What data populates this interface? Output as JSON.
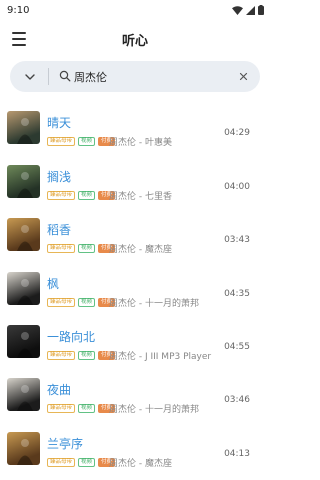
{
  "status_bar": {
    "time": "9:10"
  },
  "app_bar": {
    "title": "听心"
  },
  "search": {
    "query": "周杰伦"
  },
  "badge_labels": {
    "quality": "臻品母带",
    "video": "视频",
    "vip": "付费"
  },
  "colors": {
    "accent": "#3a8fd8",
    "search_bg": "#eaeef3"
  },
  "songs": [
    {
      "title": "晴天",
      "meta": "周杰伦 - 叶惠美",
      "duration": "04:29",
      "cover": [
        "#2c3a30",
        "#b89970"
      ]
    },
    {
      "title": "搁浅",
      "meta": "周杰伦 - 七里香",
      "duration": "04:00",
      "cover": [
        "#243226",
        "#6f8a5a"
      ]
    },
    {
      "title": "稻香",
      "meta": "周杰伦 - 魔杰座",
      "duration": "03:43",
      "cover": [
        "#5a3a1c",
        "#c89a52"
      ]
    },
    {
      "title": "枫",
      "meta": "周杰伦 - 十一月的萧邦",
      "duration": "04:35",
      "cover": [
        "#1c1c1c",
        "#d8d4cc"
      ]
    },
    {
      "title": "一路向北",
      "meta": "周杰伦 - J III MP3 Player",
      "duration": "04:55",
      "cover": [
        "#0e0e0e",
        "#3a3a3a"
      ]
    },
    {
      "title": "夜曲",
      "meta": "周杰伦 - 十一月的萧邦",
      "duration": "03:46",
      "cover": [
        "#1c1c1c",
        "#d8d4cc"
      ]
    },
    {
      "title": "兰亭序",
      "meta": "周杰伦 - 魔杰座",
      "duration": "04:13",
      "cover": [
        "#5a3a1c",
        "#c89a52"
      ]
    }
  ]
}
